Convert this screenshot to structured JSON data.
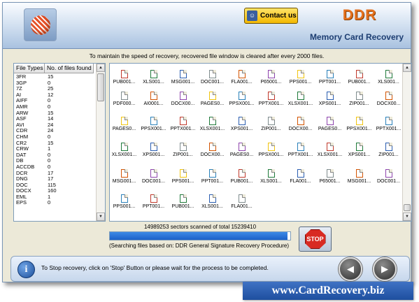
{
  "header": {
    "brand": "DDR",
    "product": "Memory Card Recovery",
    "contact_label": "Contact us"
  },
  "info_text": "To maintain the speed of recovery, recovered file window is cleared after every 2000 files.",
  "file_types": {
    "columns": [
      "File Types",
      "No. of files found"
    ],
    "rows": [
      {
        "type": "3FR",
        "count": "15"
      },
      {
        "type": "3GP",
        "count": "0"
      },
      {
        "type": "7Z",
        "count": "25"
      },
      {
        "type": "AI",
        "count": "12"
      },
      {
        "type": "AIFF",
        "count": "0"
      },
      {
        "type": "AMR",
        "count": "0"
      },
      {
        "type": "ARW",
        "count": "15"
      },
      {
        "type": "ASF",
        "count": "14"
      },
      {
        "type": "AVI",
        "count": "24"
      },
      {
        "type": "CDR",
        "count": "24"
      },
      {
        "type": "CHM",
        "count": "0"
      },
      {
        "type": "CR2",
        "count": "15"
      },
      {
        "type": "CRW",
        "count": "1"
      },
      {
        "type": "DAT",
        "count": "0"
      },
      {
        "type": "DB",
        "count": "0"
      },
      {
        "type": "ACCDB",
        "count": "0"
      },
      {
        "type": "DCR",
        "count": "17"
      },
      {
        "type": "DNG",
        "count": "17"
      },
      {
        "type": "DOC",
        "count": "115"
      },
      {
        "type": "DOCX",
        "count": "160"
      },
      {
        "type": "EML",
        "count": "1"
      },
      {
        "type": "EPS",
        "count": "0"
      }
    ]
  },
  "recovered_files": {
    "rows": [
      [
        "PUB001...",
        "XLS001...",
        "MSG001...",
        "DOC001...",
        "FLA001...",
        "P65001...",
        "PPS001...",
        "PPT001...",
        "PUB001...",
        "XLS001..."
      ],
      [
        "PDF000...",
        "AI0001...",
        "DOCX00...",
        "PAGES0...",
        "PPSX001...",
        "PPTX001...",
        "XLSX001...",
        "XPS001...",
        "ZIP001...",
        "DOCX00..."
      ],
      [
        "PAGES0...",
        "PPSX001...",
        "PPTX001...",
        "XLSX001...",
        "XPS001...",
        "ZIP001...",
        "DOCX00...",
        "PAGES0...",
        "PPSX001...",
        "PPTX001..."
      ],
      [
        "XLSX001...",
        "XPS001...",
        "ZIP001...",
        "DOCX00...",
        "PAGES0...",
        "PPSX001...",
        "PPTX001...",
        "XLSX001...",
        "XPS001...",
        "ZIP001..."
      ],
      [
        "MSG001...",
        "DOC001...",
        "PPS001...",
        "PPT001...",
        "PUB001...",
        "XLS001...",
        "FLA001...",
        "P65001...",
        "MSG001...",
        "DOC001..."
      ],
      [
        "PPS001...",
        "PPT001...",
        "PUB001...",
        "XLS001...",
        "FLA001..."
      ]
    ],
    "icon_colors": [
      "#c0392b",
      "#1f7a3a",
      "#2a5db0",
      "#7f8c8d",
      "#d35400",
      "#8e44ad",
      "#f1c40f",
      "#2980b9"
    ]
  },
  "progress": {
    "sectors_text": "14989253 sectors scanned of total 15239410",
    "fraction": 0.983,
    "searching_text": "(Searching files based on:  DDR General Signature Recovery Procedure)"
  },
  "stop_label": "STOP",
  "status": {
    "info_symbol": "i",
    "text": "To Stop recovery, click on 'Stop' Button or please wait for the process to be completed."
  },
  "nav": {
    "back_symbol": "◀",
    "next_symbol": "▶"
  },
  "footer_url": "www.CardRecovery.biz"
}
